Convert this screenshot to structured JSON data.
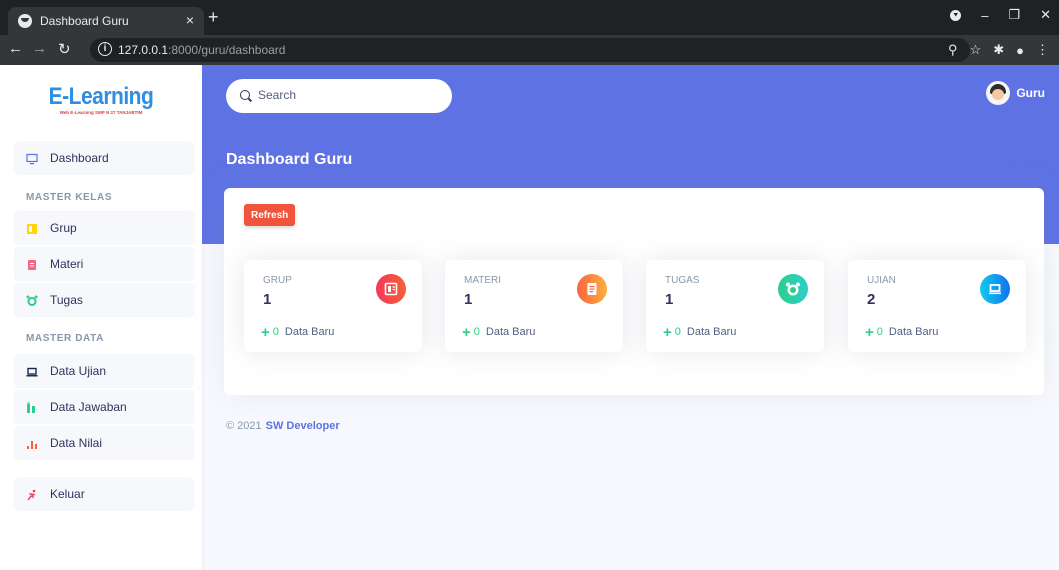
{
  "browser": {
    "tab_title": "Dashboard Guru",
    "tab_close": "×",
    "new_tab": "+",
    "url_host": "127.0.0.1",
    "url_rest": ":8000/guru/dashboard"
  },
  "brand": {
    "logo": "E-Learning",
    "logo_sub": "Web E-Learning SMP N 27 TANJABTIM"
  },
  "sidebar": {
    "dashboard": "Dashboard",
    "section_kelas": "MASTER KELAS",
    "grup": "Grup",
    "materi": "Materi",
    "tugas": "Tugas",
    "section_data": "MASTER DATA",
    "data_ujian": "Data Ujian",
    "data_jawaban": "Data Jawaban",
    "data_nilai": "Data Nilai",
    "keluar": "Keluar"
  },
  "header": {
    "search_placeholder": "Search",
    "user_name": "Guru",
    "page_title": "Dashboard Guru"
  },
  "main": {
    "refresh_label": "Refresh",
    "cards": [
      {
        "label": "GRUP",
        "value": "1",
        "new_count": "0",
        "new_label": "Data Baru",
        "icon": "group-icon",
        "color": "#f5365c"
      },
      {
        "label": "MATERI",
        "value": "1",
        "new_count": "0",
        "new_label": "Data Baru",
        "icon": "document-icon",
        "color": "#fb6340"
      },
      {
        "label": "TUGAS",
        "value": "1",
        "new_count": "0",
        "new_label": "Data Baru",
        "icon": "alarm-clock-icon",
        "color": "#2dce89"
      },
      {
        "label": "UJIAN",
        "value": "2",
        "new_count": "0",
        "new_label": "Data Baru",
        "icon": "laptop-icon",
        "color": "#11cdef"
      }
    ]
  },
  "footer": {
    "copyright": "© 2021",
    "developer": "SW Developer"
  }
}
